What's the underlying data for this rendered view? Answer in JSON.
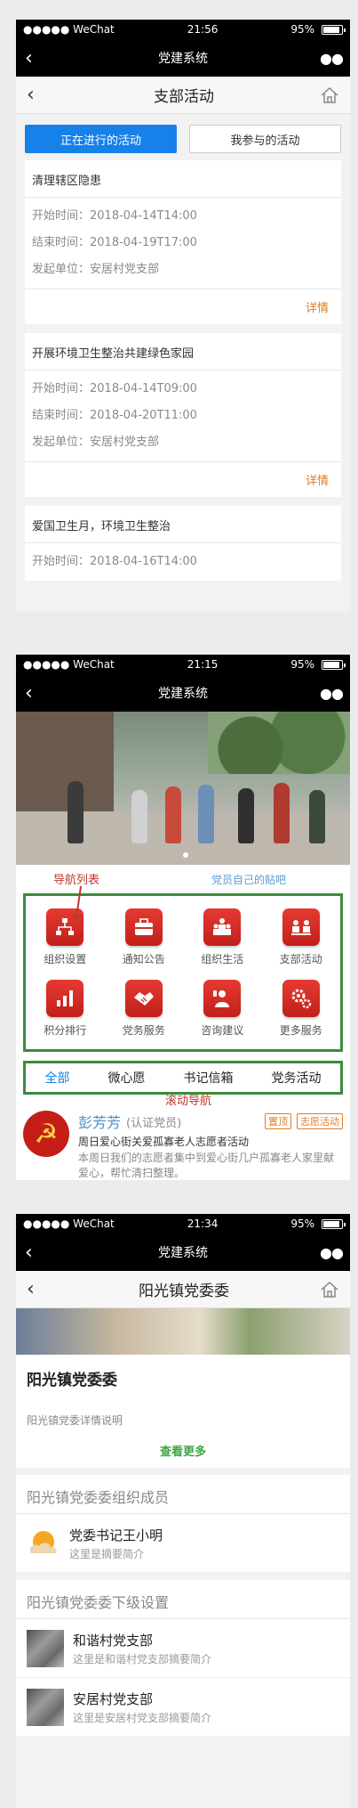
{
  "statusbar": {
    "carrier": "●●●●● WeChat",
    "battery": "95%"
  },
  "app_title": "党建系统",
  "p1": {
    "time": "21:56",
    "nav_title": "支部活动",
    "tabs": [
      "正在进行的活动",
      "我参与的活动"
    ],
    "activities": [
      {
        "title": "清理辖区隐患",
        "start": "开始时间：2018-04-14T14:00",
        "end": "结束时间：2018-04-19T17:00",
        "org": "发起单位：安居村党支部"
      },
      {
        "title": "开展环境卫生整治共建绿色家园",
        "start": "开始时间：2018-04-14T09:00",
        "end": "结束时间：2018-04-20T11:00",
        "org": "发起单位：安居村党支部"
      },
      {
        "title": "爱国卫生月，环境卫生整治",
        "start": "开始时间：2018-04-16T14:00"
      }
    ],
    "detail_label": "详情"
  },
  "p2": {
    "time": "21:15",
    "annot_nav": "导航列表",
    "annot_post": "党员自己的贴吧",
    "annot_scroll": "滚动导航",
    "grid": [
      {
        "label": "组织设置",
        "icon": "org-chart-icon"
      },
      {
        "label": "通知公告",
        "icon": "briefcase-icon"
      },
      {
        "label": "组织生活",
        "icon": "people-icon"
      },
      {
        "label": "支部活动",
        "icon": "meeting-icon"
      },
      {
        "label": "积分排行",
        "icon": "bar-chart-icon"
      },
      {
        "label": "党务服务",
        "icon": "handshake-icon"
      },
      {
        "label": "咨询建议",
        "icon": "user-phone-icon"
      },
      {
        "label": "更多服务",
        "icon": "gears-icon"
      }
    ],
    "scroll_tabs": [
      "全部",
      "微心愿",
      "书记信箱",
      "党务活动"
    ],
    "post": {
      "name": "彭芳芳",
      "cert": "(认证党员)",
      "tag_top": "置顶",
      "tag_type": "志愿活动",
      "subtitle": "周日爱心街关爱孤寡老人志愿者活动",
      "desc": "本周日我们的志愿者集中到爱心街几户孤寡老人家里献爱心，帮忙清扫整理。"
    }
  },
  "p3": {
    "time": "21:34",
    "nav_title": "阳光镇党委委",
    "name": "阳光镇党委委",
    "desc": "阳光镇党委详情说明",
    "more": "查看更多",
    "members_head": "阳光镇党委委组织成员",
    "members": [
      {
        "title": "党委书记王小明",
        "summary": "这里是摘要简介"
      }
    ],
    "subs_head": "阳光镇党委委下级设置",
    "subs": [
      {
        "title": "和谐村党支部",
        "summary": "这里是和谐村党支部摘要简介"
      },
      {
        "title": "安居村党支部",
        "summary": "这里是安居村党支部摘要简介"
      }
    ]
  }
}
